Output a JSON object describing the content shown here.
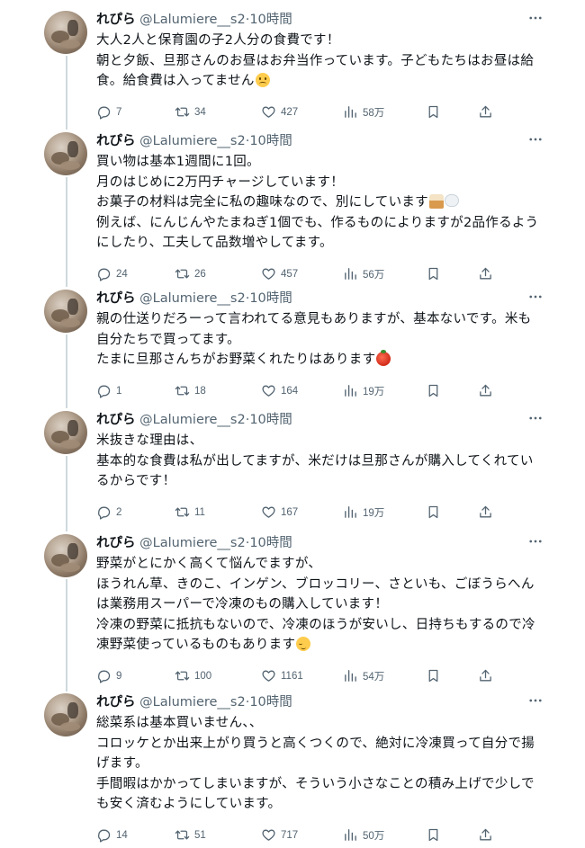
{
  "tweets": [
    {
      "name": "れぴら",
      "handle": "@Lalumiere__s2",
      "sep": "·",
      "time": "10時間",
      "lines": [
        "大人2人と保育園の子2人分の食費です！",
        "朝と夕飯、旦那さんのお昼はお弁当作っています。子どもたちはお昼は給",
        "食。給食費は入ってません"
      ],
      "emoji": [
        "",
        "",
        "sad-face"
      ],
      "replies": "7",
      "retweets": "34",
      "likes": "427",
      "views": "58万"
    },
    {
      "name": "れぴら",
      "handle": "@Lalumiere__s2",
      "sep": "·",
      "time": "10時間",
      "lines": [
        "買い物は基本1週間に1回。",
        "月のはじめに2万円チャージしています！",
        "お菓子の材料は完全に私の趣味なので、別にしています",
        "例えば、にんじんやたまねぎ1個でも、作るものによりますが2品作るよう",
        "にしたり、工夫して品数増やしてます。"
      ],
      "emoji": [
        "",
        "",
        "cupcake-cloud",
        "",
        ""
      ],
      "replies": "24",
      "retweets": "26",
      "likes": "457",
      "views": "56万"
    },
    {
      "name": "れぴら",
      "handle": "@Lalumiere__s2",
      "sep": "·",
      "time": "10時間",
      "lines": [
        "親の仕送りだろーって言われてる意見もありますが、基本ないです。米も",
        "自分たちで買ってます。",
        "たまに旦那さんちがお野菜くれたりはあります"
      ],
      "emoji": [
        "",
        "",
        "tomato"
      ],
      "replies": "1",
      "retweets": "18",
      "likes": "164",
      "views": "19万"
    },
    {
      "name": "れぴら",
      "handle": "@Lalumiere__s2",
      "sep": "·",
      "time": "10時間",
      "lines": [
        "米抜きな理由は、",
        "基本的な食費は私が出してますが、米だけは旦那さんが購入してくれてい",
        "るからです！"
      ],
      "emoji": [
        "",
        "",
        ""
      ],
      "replies": "2",
      "retweets": "11",
      "likes": "167",
      "views": "19万"
    },
    {
      "name": "れぴら",
      "handle": "@Lalumiere__s2",
      "sep": "·",
      "time": "10時間",
      "lines": [
        "野菜がとにかく高くて悩んでますが、",
        "ほうれん草、きのこ、インゲン、ブロッコリー、さといも、ごぼうらへん",
        "は業務用スーパーで冷凍のもの購入しています！",
        "冷凍の野菜に抵抗もないので、冷凍のほうが安いし、日持ちもするので冷",
        "凍野菜使っているものもあります"
      ],
      "emoji": [
        "",
        "",
        "",
        "",
        "relieved-face"
      ],
      "replies": "9",
      "retweets": "100",
      "likes": "1161",
      "views": "54万"
    },
    {
      "name": "れぴら",
      "handle": "@Lalumiere__s2",
      "sep": "·",
      "time": "10時間",
      "lines": [
        "総菜系は基本買いません、、",
        "コロッケとか出来上がり買うと高くつくので、絶対に冷凍買って自分で揚",
        "げます。",
        "手間暇はかかってしまいますが、そういう小さなことの積み上げで少しで",
        "も安く済むようにしています。"
      ],
      "emoji": [
        "",
        "",
        "",
        "",
        ""
      ],
      "replies": "14",
      "retweets": "51",
      "likes": "717",
      "views": "50万"
    }
  ],
  "icons": {
    "avatar": "user-avatar",
    "more": "more-dots-icon",
    "reply": "reply-icon",
    "retweet": "retweet-icon",
    "like": "heart-icon",
    "views": "views-bar-chart-icon",
    "bookmark": "bookmark-icon",
    "share": "share-icon"
  },
  "colors": {
    "text": "#0f1419",
    "secondary": "#536471",
    "thread_line": "#cfd9de",
    "background": "#ffffff"
  }
}
